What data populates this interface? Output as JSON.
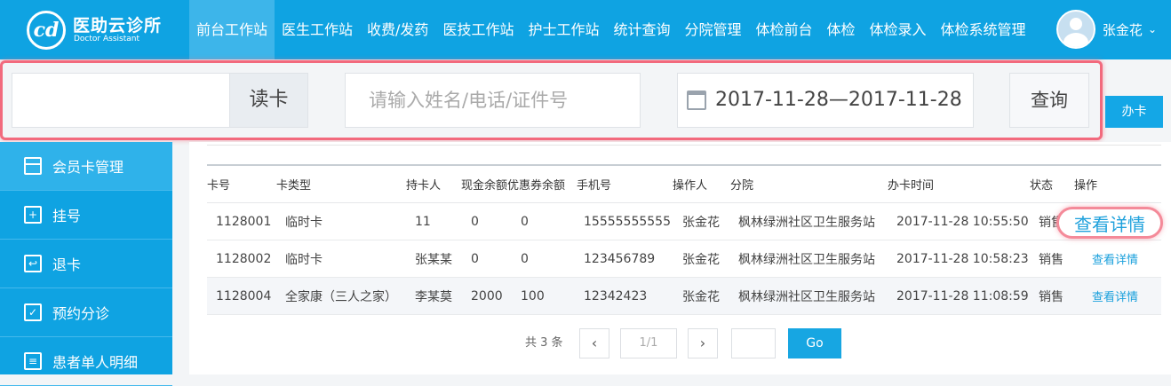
{
  "logo": {
    "mark": "cd",
    "title": "医助云诊所",
    "subtitle": "Doctor Assistant"
  },
  "nav": [
    {
      "label": "前台工作站",
      "active": true
    },
    {
      "label": "医生工作站"
    },
    {
      "label": "收费/发药"
    },
    {
      "label": "医技工作站"
    },
    {
      "label": "护士工作站"
    },
    {
      "label": "统计查询"
    },
    {
      "label": "分院管理"
    },
    {
      "label": "体检前台"
    },
    {
      "label": "体检"
    },
    {
      "label": "体检录入"
    },
    {
      "label": "体检系统管理"
    }
  ],
  "user": {
    "name": "张金花"
  },
  "sidebar": {
    "items": [
      {
        "label": "会员卡管理",
        "active": true
      },
      {
        "label": "挂号"
      },
      {
        "label": "退卡"
      },
      {
        "label": "预约分诊"
      },
      {
        "label": "患者单人明细"
      }
    ]
  },
  "search": {
    "card_value": "",
    "read_card_label": "读卡",
    "name_placeholder": "请输入姓名/电话/证件号",
    "date_range": "2017-11-28—2017-11-28",
    "query_label": "查询"
  },
  "issue_card_label": "办卡",
  "table": {
    "headers": [
      "卡号",
      "卡类型",
      "持卡人",
      "现金余额",
      "优惠券余额",
      "手机号",
      "操作人",
      "分院",
      "办卡时间",
      "状态",
      "操作"
    ],
    "rows": [
      {
        "card_no": "1128001",
        "type": "临时卡",
        "holder": "11",
        "cash": "0",
        "coupon": "0",
        "phone": "15555555555",
        "operator": "张金花",
        "branch": "枫林绿洲社区卫生服务站",
        "time": "2017-11-28 10:55:50",
        "status": "销售",
        "action": "查看详情"
      },
      {
        "card_no": "1128002",
        "type": "临时卡",
        "holder": "张某某",
        "cash": "0",
        "coupon": "0",
        "phone": "123456789",
        "operator": "张金花",
        "branch": "枫林绿洲社区卫生服务站",
        "time": "2017-11-28 10:58:23",
        "status": "销售",
        "action": "查看详情"
      },
      {
        "card_no": "1128004",
        "type": "全家康（三人之家）",
        "holder": "李某莫",
        "cash": "2000",
        "coupon": "100",
        "phone": "12342423",
        "operator": "张金花",
        "branch": "枫林绿洲社区卫生服务站",
        "time": "2017-11-28 11:08:59",
        "status": "销售",
        "action": "查看详情"
      }
    ]
  },
  "pager": {
    "total": "共 3 条",
    "prev": "‹",
    "page_info": "1/1",
    "next": "›",
    "go_label": "Go"
  }
}
